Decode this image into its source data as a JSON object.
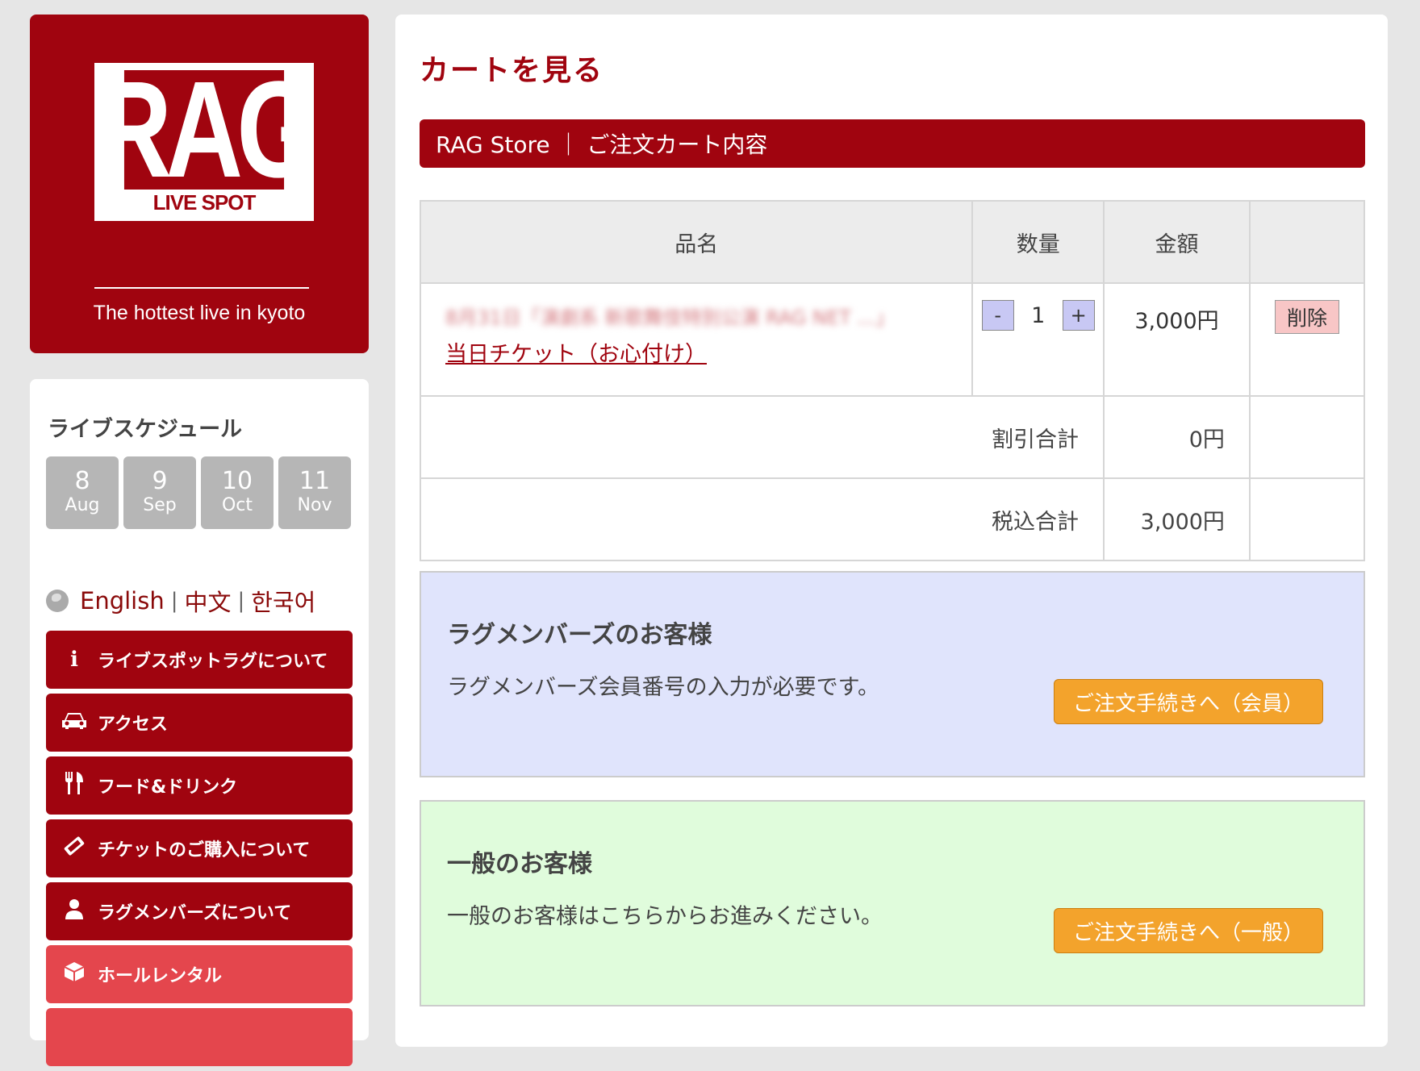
{
  "logo": {
    "name": "RAG",
    "sub": "LIVE SPOT",
    "tagline": "The hottest live in kyoto"
  },
  "sidebar": {
    "schedule_title": "ライブスケジュール",
    "months": [
      {
        "num": "8",
        "mon": "Aug"
      },
      {
        "num": "9",
        "mon": "Sep"
      },
      {
        "num": "10",
        "mon": "Oct"
      },
      {
        "num": "11",
        "mon": "Nov"
      }
    ],
    "languages": [
      "English",
      "中文",
      "한국어"
    ],
    "menu": [
      {
        "label": "ライブスポットラグについて",
        "icon": "info-icon"
      },
      {
        "label": "アクセス",
        "icon": "car-icon"
      },
      {
        "label": "フード&ドリンク",
        "icon": "fork-knife-icon"
      },
      {
        "label": "チケットのご購入について",
        "icon": "ticket-icon"
      },
      {
        "label": "ラグメンバーズについて",
        "icon": "user-icon"
      },
      {
        "label": "ホールレンタル",
        "icon": "box-icon"
      }
    ]
  },
  "main": {
    "title": "カートを見る",
    "store_bar": "RAG Store ｜ ご注文カート内容",
    "table": {
      "headers": [
        "品名",
        "数量",
        "金額",
        ""
      ],
      "item": {
        "blurred_name": "8月31日「演劇系 新歌舞伎特別公演 RAG NET ...」",
        "link": "当日チケット（お心付け）",
        "qty": "1",
        "price": "3,000円",
        "delete": "削除",
        "minus": "-",
        "plus": "+"
      },
      "discount_label": "割引合計",
      "discount_value": "0円",
      "total_label": "税込合計",
      "total_value": "3,000円"
    },
    "member_box": {
      "title": "ラグメンバーズのお客様",
      "text": "ラグメンバーズ会員番号の入力が必要です。",
      "button": "ご注文手続きへ（会員）"
    },
    "general_box": {
      "title": "一般のお客様",
      "text": "一般のお客様はこちらからお進みください。",
      "button": "ご注文手続きへ（一般）"
    }
  },
  "colors": {
    "brand_red": "#a0040f",
    "light_red": "#e4464d",
    "order_button": "#f3a32c",
    "member_bg": "#e0e4fc",
    "general_bg": "#e0fcdc"
  }
}
